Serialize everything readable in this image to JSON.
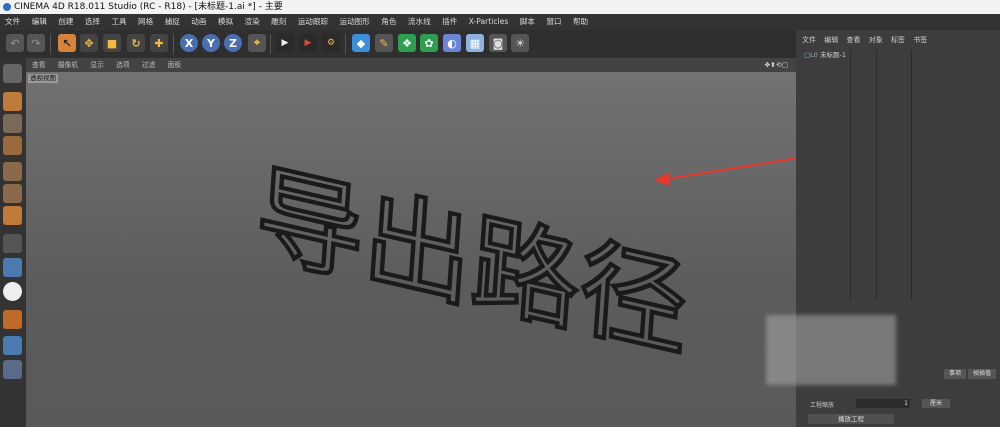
{
  "window": {
    "title": "CINEMA 4D R18.011 Studio (RC - R18) - [未标题-1.ai *] - 主要"
  },
  "menu": [
    "文件",
    "编辑",
    "创建",
    "选择",
    "工具",
    "网格",
    "捕捉",
    "动画",
    "模拟",
    "渲染",
    "雕刻",
    "运动跟踪",
    "运动图形",
    "角色",
    "流水线",
    "插件",
    "X-Particles",
    "脚本",
    "窗口",
    "帮助"
  ],
  "viewport": {
    "menu": [
      "查看",
      "摄像机",
      "显示",
      "选项",
      "过滤",
      "面板"
    ],
    "label": "透视视图",
    "outlined_text": "导出路径"
  },
  "toolbar": {
    "axes": [
      "X",
      "Y",
      "Z"
    ]
  },
  "right_panel": {
    "tabs": [
      "文件",
      "编辑",
      "查看",
      "对象",
      "标签",
      "书签"
    ],
    "object_name": "未标题-1",
    "bottom_buttons": [
      "事项",
      "帧插值"
    ],
    "bottom_field_label": "工程缩放",
    "bottom_field_value": "1",
    "bottom_unit": "厘米",
    "play_button": "播放工程"
  },
  "colors": {
    "accent_blue": "#2d6fc0",
    "arrow_red": "#e8372b"
  }
}
